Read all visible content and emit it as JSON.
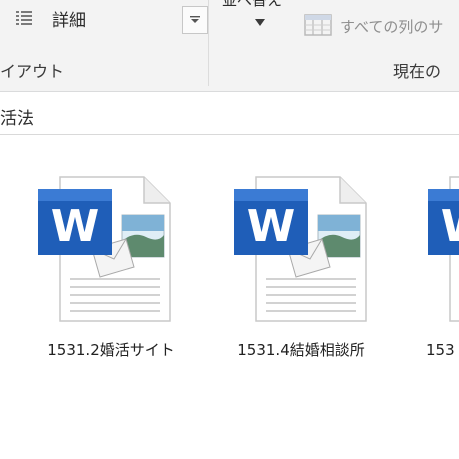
{
  "ribbon": {
    "details_label": "詳細",
    "layout_group_label": "イアウト",
    "sort_label": "並べ替え",
    "column_fit_label": "すべての列のサ",
    "current_view_group_label": "現在の"
  },
  "address_bar": {
    "path_text": "活法"
  },
  "files": [
    {
      "name": "1531.2婚活サイト",
      "icon": "word-document-icon"
    },
    {
      "name": "1531.4結婚相談所",
      "icon": "word-document-icon"
    },
    {
      "name": "153",
      "icon": "word-document-icon"
    }
  ],
  "colors": {
    "ribbon_bg": "#f3f3f3",
    "word_blue": "#1f5eb8",
    "window_bg": "#ffffff"
  }
}
